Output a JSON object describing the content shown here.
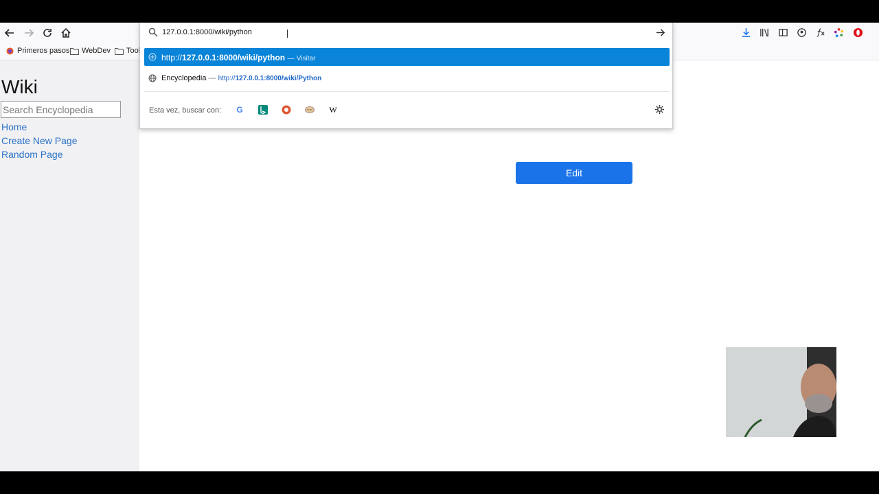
{
  "url_bar": {
    "value": "127.0.0.1:8000/wiki/python"
  },
  "suggestions": [
    {
      "prefix": "http://",
      "bold": "127.0.0.1:8000/wiki/python",
      "sep": "—",
      "action": "Visitar"
    },
    {
      "title": "Encyclopedia",
      "sep": "—",
      "url_prefix": "http://",
      "url_bold": "127.0.0.1:8000/wiki/Python"
    }
  ],
  "oneoff": {
    "label": "Esta vez, buscar con:"
  },
  "search_engines": [
    "google-icon",
    "bing-icon",
    "duckduckgo-icon",
    "ebay-icon",
    "wikipedia-icon"
  ],
  "bookmarks": [
    {
      "label": "Primeros pasos",
      "icon": "firefox-icon"
    },
    {
      "label": "WebDev",
      "icon": "folder-icon"
    },
    {
      "label": "Tool",
      "icon": "folder-icon"
    }
  ],
  "sidebar": {
    "title": "Wiki",
    "search_placeholder": "Search Encyclopedia",
    "links": [
      "Home",
      "Create New Page",
      "Random Page"
    ]
  },
  "main": {
    "edit_label": "Edit"
  },
  "colors": {
    "accent": "#0a84d8",
    "button": "#1a73e8",
    "link": "#2a72c7"
  }
}
